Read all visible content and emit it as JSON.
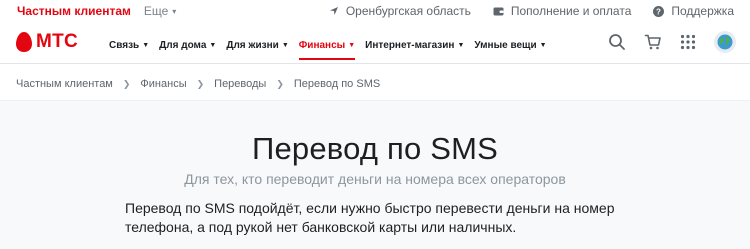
{
  "topbar": {
    "segment_active": "Частным клиентам",
    "segment_more": "Еще",
    "region": "Оренбургская область",
    "payment": "Пополнение и оплата",
    "support": "Поддержка"
  },
  "brand": {
    "name": "МТС",
    "color": "#e30611"
  },
  "nav": {
    "items": [
      {
        "label": "Связь",
        "active": false
      },
      {
        "label": "Для дома",
        "active": false
      },
      {
        "label": "Для жизни",
        "active": false
      },
      {
        "label": "Финансы",
        "active": true
      },
      {
        "label": "Интернет-магазин",
        "active": false
      },
      {
        "label": "Умные вещи",
        "active": false
      }
    ]
  },
  "icons": [
    "search-icon",
    "cart-icon",
    "apps-grid-icon",
    "profile-avatar-icon",
    "location-icon",
    "wallet-icon",
    "help-icon",
    "chevron-down-icon",
    "chevron-right-icon"
  ],
  "breadcrumb": [
    "Частным клиентам",
    "Финансы",
    "Переводы",
    "Перевод по SMS"
  ],
  "page": {
    "title": "Перевод по SMS",
    "subtitle": "Для тех, кто переводит деньги на номера всех операторов",
    "paragraph": "Перевод по SMS подойдёт, если нужно быстро перевести деньги на номер телефона, а под рукой нет банковской карты или наличных."
  }
}
